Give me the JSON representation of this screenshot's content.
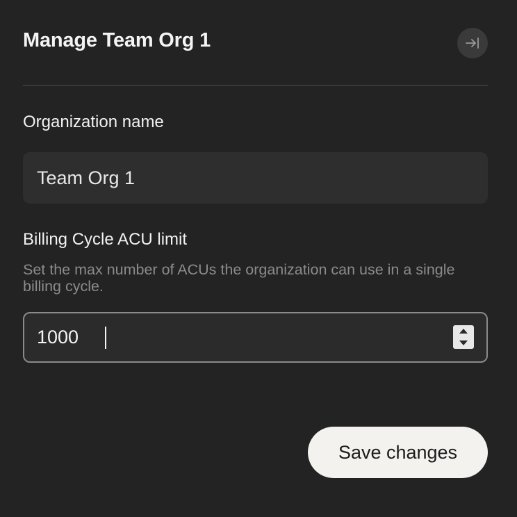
{
  "header": {
    "title": "Manage Team Org 1",
    "collapse_icon": "collapse-right-icon"
  },
  "organization": {
    "label": "Organization name",
    "value": "Team Org 1"
  },
  "billing": {
    "label": "Billing Cycle ACU limit",
    "help": "Set the max number of ACUs the organization can use in a single billing cycle.",
    "value": "1000"
  },
  "actions": {
    "save_label": "Save changes"
  },
  "colors": {
    "background": "#232323",
    "input_background": "#2e2e2e",
    "button_background": "#f4f2ee",
    "muted_text": "#8b8b8b"
  }
}
